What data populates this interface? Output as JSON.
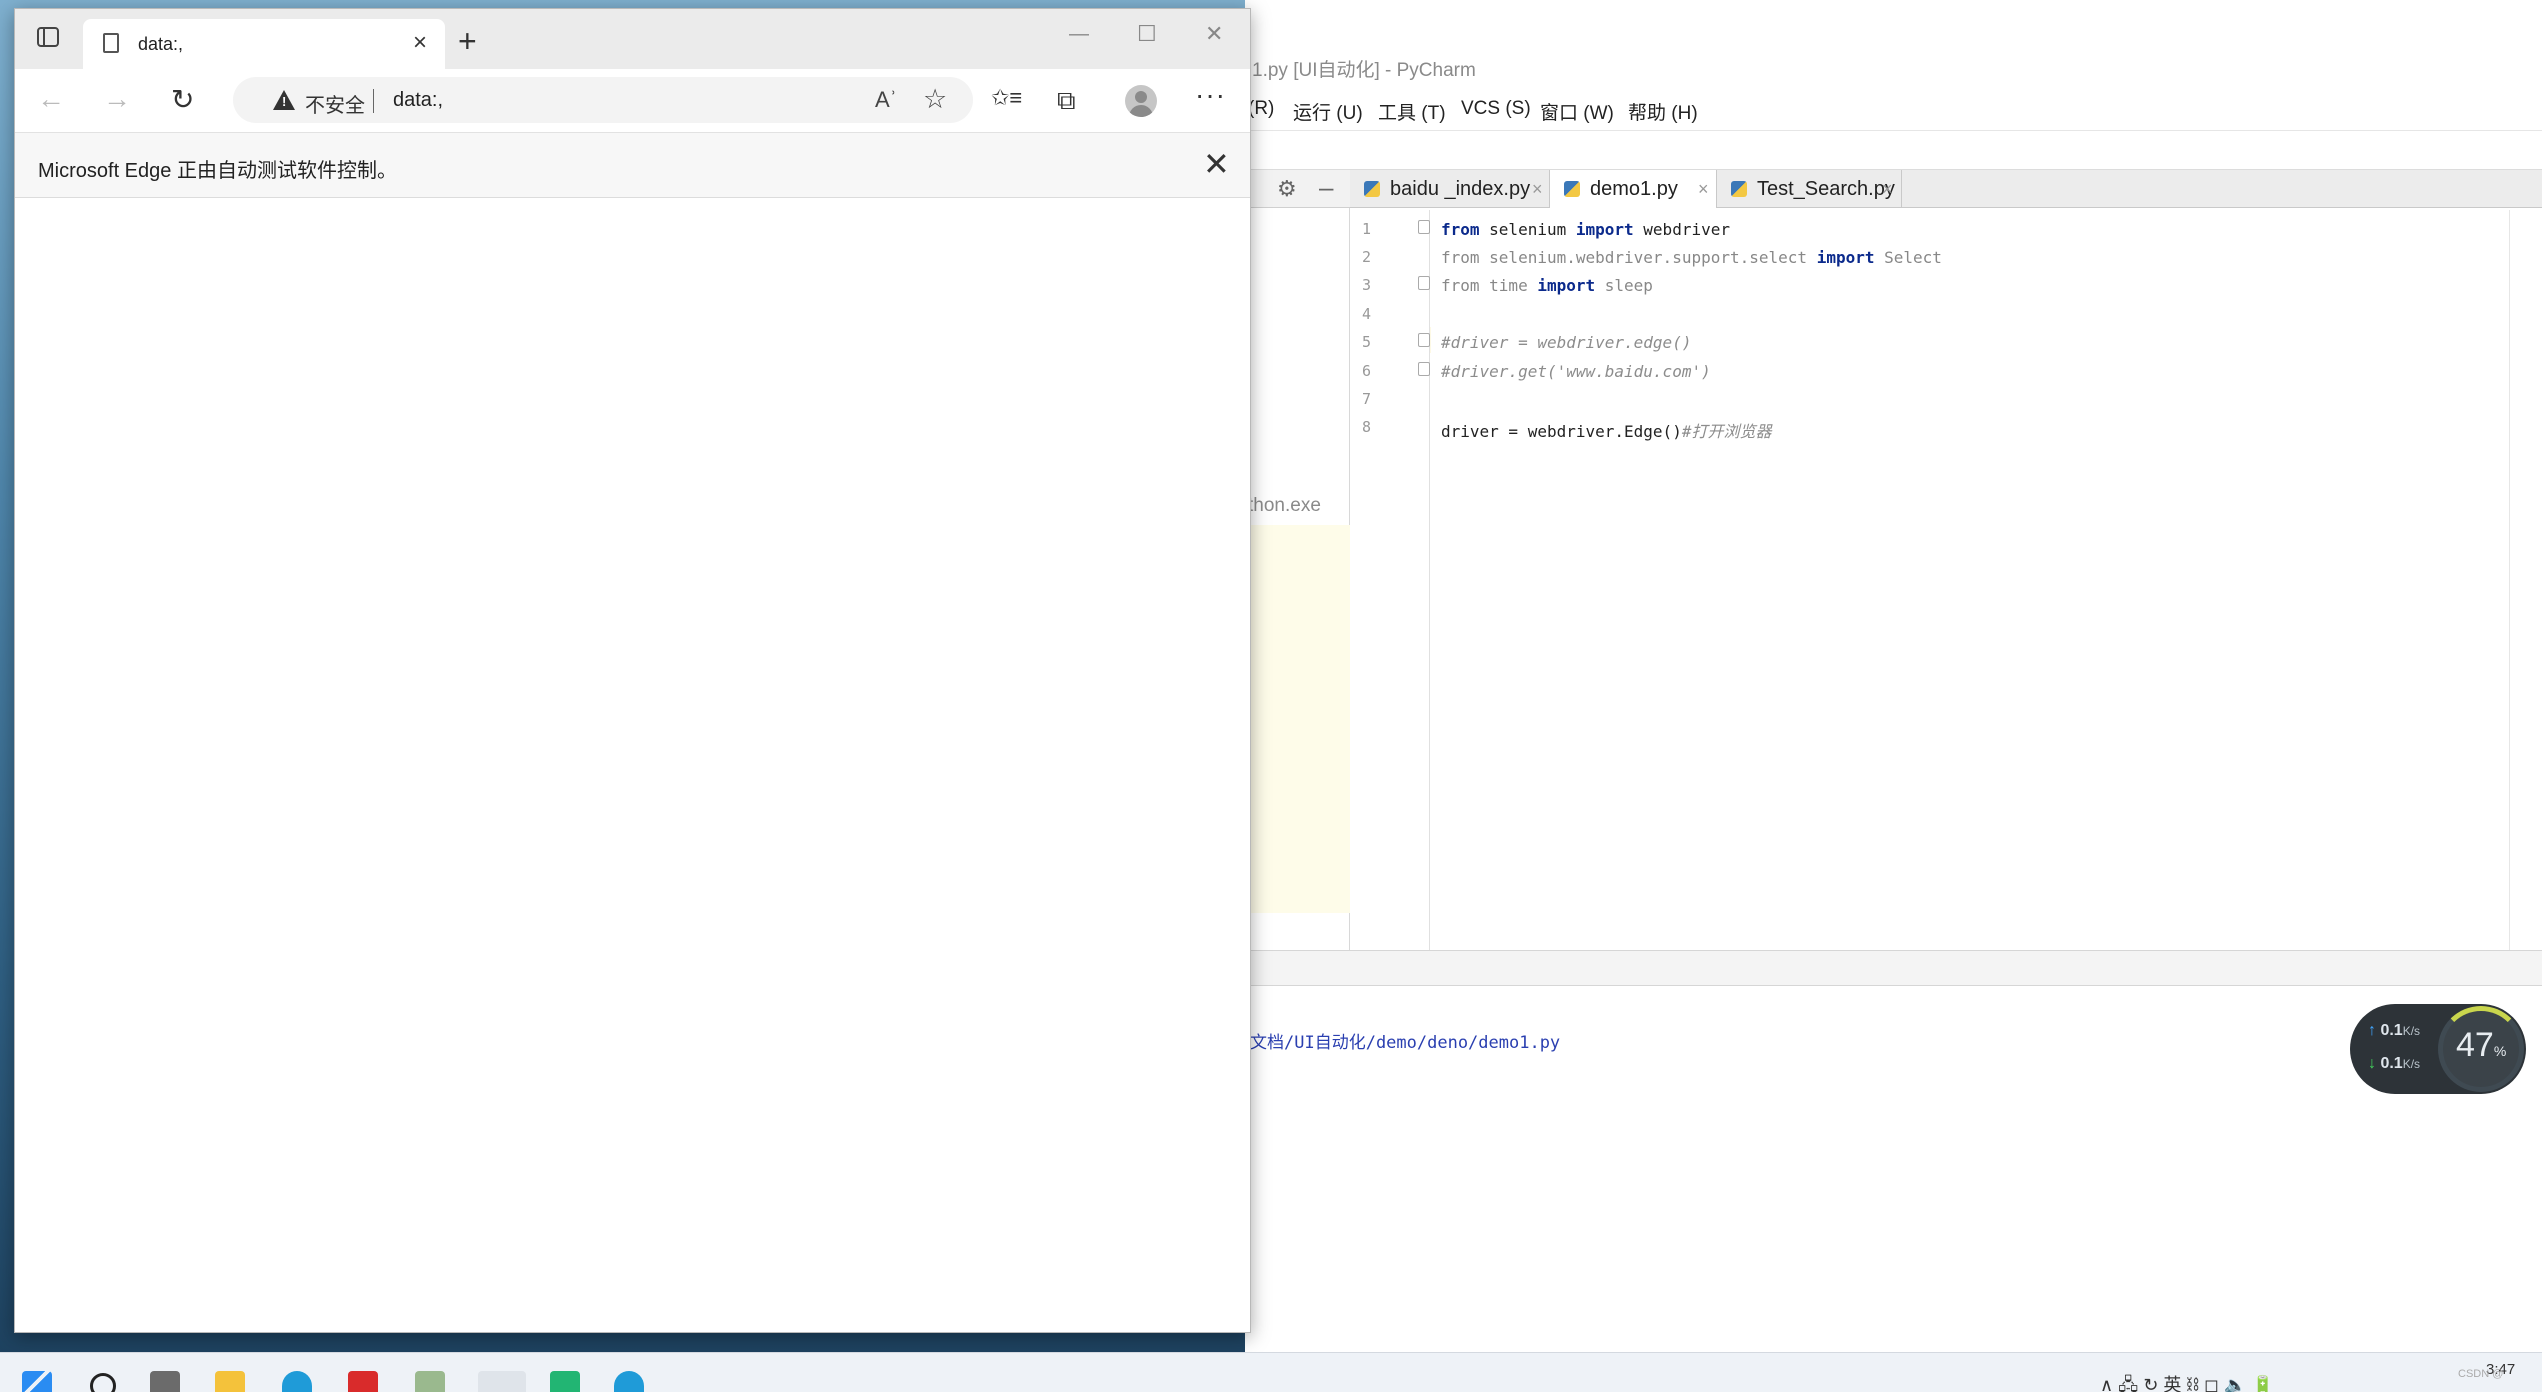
{
  "desktop": {
    "icons": [
      "folder",
      "folder",
      "word-doc",
      "word-doc"
    ]
  },
  "pycharm": {
    "title": "1.py [UI自动化] - PyCharm",
    "menu": [
      "(R)",
      "运行 (U)",
      "工具 (T)",
      "VCS (S)",
      "窗口 (W)",
      "帮助 (H)"
    ],
    "project_panel_text": "thon.exe",
    "tabs": [
      {
        "label": "baidu _index.py",
        "active": false
      },
      {
        "label": "demo1.py",
        "active": true
      },
      {
        "label": "Test_Search.py",
        "active": false
      }
    ],
    "close_glyph": "×",
    "line_numbers": [
      "1",
      "2",
      "3",
      "4",
      "5",
      "6",
      "7",
      "8"
    ],
    "code": {
      "l1_from": "from",
      "l1_mod": " selenium ",
      "l1_import": "import",
      "l1_name": " webdriver",
      "l2_from": "from",
      "l2_mod": " selenium.webdriver.support.select ",
      "l2_import": "import",
      "l2_name": " Select",
      "l3_from": "from",
      "l3_mod": " time ",
      "l3_import": "import",
      "l3_name": " sleep",
      "l5": "#driver = webdriver.edge()",
      "l6": "#driver.get('www.baidu.com')",
      "l8_code": "driver = webdriver.Edge()",
      "l8_comment": "#打开浏览器"
    },
    "run_output_path": "文档/UI自动化/demo/deno/demo1.py"
  },
  "netwidget": {
    "up_value": "0.1",
    "down_value": "0.1",
    "unit": "K/s",
    "percent": "47",
    "percent_sign": "%",
    "up_arrow": "↑",
    "down_arrow": "↓"
  },
  "edge": {
    "tab_title": "data:,",
    "tab_close": "×",
    "new_tab": "+",
    "minimize": "—",
    "maximize": "☐",
    "close": "✕",
    "back": "←",
    "forward": "→",
    "refresh": "↻",
    "security_label": "不安全",
    "url": "data:,",
    "read_aloud": "Aʾ",
    "add_favorite": "☆",
    "favorites": "✩≡",
    "collections": "⧉",
    "more": "···",
    "infobar_message": "Microsoft Edge 正由自动测试软件控制。",
    "infobar_close": "✕"
  },
  "taskbar": {
    "tray_text": "∧ 🖧 ↻ 英 ⛓ ◻ 🔈 🔋",
    "clock": "3:47",
    "watermark": "CSDN @"
  }
}
